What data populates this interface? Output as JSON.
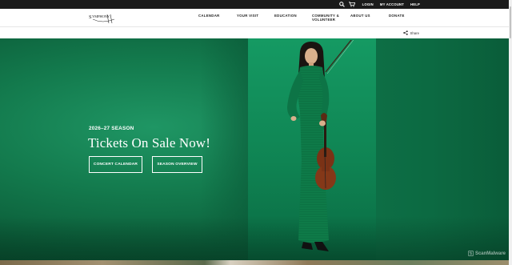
{
  "utility": {
    "login_label": "LOGIN",
    "account_label": "MY ACCOUNT",
    "help_label": "HELP",
    "search_icon": "search-icon",
    "cart_icon": "cart-icon"
  },
  "logo": {
    "text": "SYMPHONY"
  },
  "nav": {
    "items": [
      {
        "label": "CALENDAR"
      },
      {
        "label": "YOUR VISIT"
      },
      {
        "label": "EDUCATION"
      },
      {
        "label": "COMMUNITY &",
        "label2": "VOLUNTEER"
      },
      {
        "label": "ABOUT US"
      },
      {
        "label": "DONATE"
      }
    ]
  },
  "share": {
    "label": "Share",
    "icon": "share-icon"
  },
  "hero": {
    "season": "2026–27 SEASON",
    "headline": "Tickets On Sale Now!",
    "buttons": [
      {
        "label": "CONCERT CALENDAR"
      },
      {
        "label": "SEASON OVERVIEW"
      }
    ]
  },
  "watermark": {
    "text": "ScanMalware"
  },
  "colors": {
    "hero_green": "#137a4d",
    "utility_bar": "#1b1b1b"
  }
}
